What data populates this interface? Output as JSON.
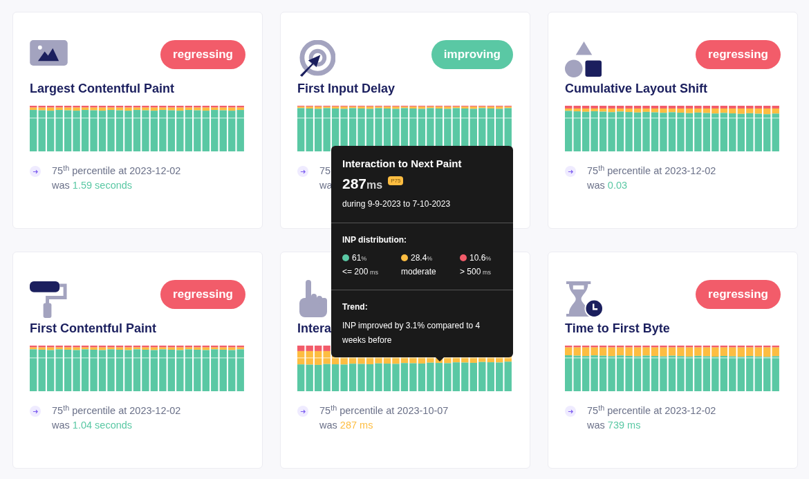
{
  "cards": [
    {
      "title": "Largest Contentful Paint",
      "badge": {
        "label": "regressing",
        "kind": "regressing"
      },
      "footer": {
        "line": "75$^{th}$ percentile at 2023-12-02",
        "was": "was",
        "value": "1.59 seconds",
        "color": "#5ac8a4"
      }
    },
    {
      "title": "First Input Delay",
      "badge": {
        "label": "improving",
        "kind": "improving"
      },
      "footer": {
        "line": "75",
        "was": "wa"
      }
    },
    {
      "title": "Cumulative Layout Shift",
      "badge": {
        "label": "regressing",
        "kind": "regressing"
      },
      "footer": {
        "line": "75$^{th}$ percentile at 2023-12-02",
        "was": "was",
        "value": "0.03",
        "color": "#5ac8a4"
      }
    },
    {
      "title": "First Contentful Paint",
      "badge": {
        "label": "regressing",
        "kind": "regressing"
      },
      "footer": {
        "line": "75$^{th}$ percentile at 2023-12-02",
        "was": "was",
        "value": "1.04 seconds",
        "color": "#5ac8a4"
      }
    },
    {
      "title": "Intera",
      "footer": {
        "line": "75$^{th}$ percentile at 2023-10-07",
        "was": "was",
        "value": "287 ms",
        "color": "#fdbd41"
      }
    },
    {
      "title": "Time to First Byte",
      "badge": {
        "label": "regressing",
        "kind": "regressing"
      },
      "footer": {
        "line": "75$^{th}$ percentile at 2023-12-02",
        "was": "was",
        "value": "739 ms",
        "color": "#5ac8a4"
      }
    }
  ],
  "tooltip": {
    "title": "Interaction to Next Paint",
    "value": "287",
    "unit": "ms",
    "badge": "P75",
    "range": "during 9-9-2023 to 7-10-2023",
    "distribution_heading": "INP distribution:",
    "distribution": [
      {
        "value": "61",
        "unit": "%",
        "label": "<= 200",
        "label_unit": "ms",
        "color": "#5ac8a4"
      },
      {
        "value": "28.4",
        "unit": "%",
        "label": "moderate",
        "color": "#fdbd41"
      },
      {
        "value": "10.6",
        "unit": "%",
        "label": "> 500",
        "label_unit": "ms",
        "color": "#f25c6a"
      }
    ],
    "trend_heading": "Trend:",
    "trend": "INP improved by 3.1% compared to 4 weeks before"
  }
}
